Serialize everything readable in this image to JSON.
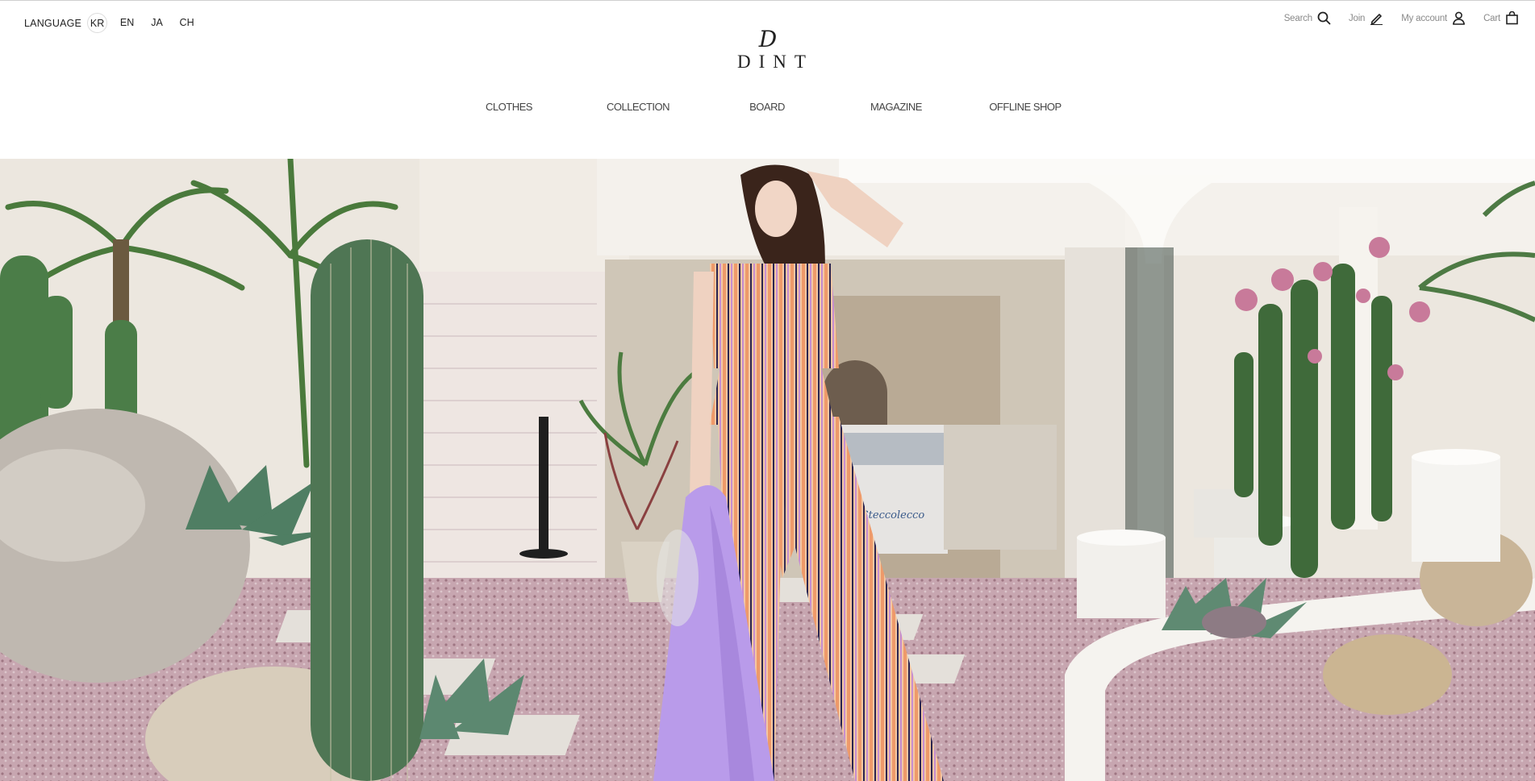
{
  "language": {
    "label": "LANGUAGE",
    "options": [
      "KR",
      "EN",
      "JA",
      "CH"
    ],
    "selected": "KR"
  },
  "util": {
    "search": "Search",
    "join": "Join",
    "account": "My account",
    "cart": "Cart"
  },
  "logo": {
    "mark": "D",
    "wordmark": "DINT"
  },
  "nav": [
    {
      "label": "CLOTHES"
    },
    {
      "label": "COLLECTION"
    },
    {
      "label": "BOARD"
    },
    {
      "label": "MAGAZINE"
    },
    {
      "label": "OFFLINE SHOP"
    }
  ],
  "hero": {
    "storefront_sign": "Steccolecco"
  },
  "colors": {
    "text": "#333333",
    "muted": "#8a8a8a",
    "stripe_orange": "#f0a070",
    "stripe_navy": "#2a2550",
    "lavender": "#b99bea"
  }
}
